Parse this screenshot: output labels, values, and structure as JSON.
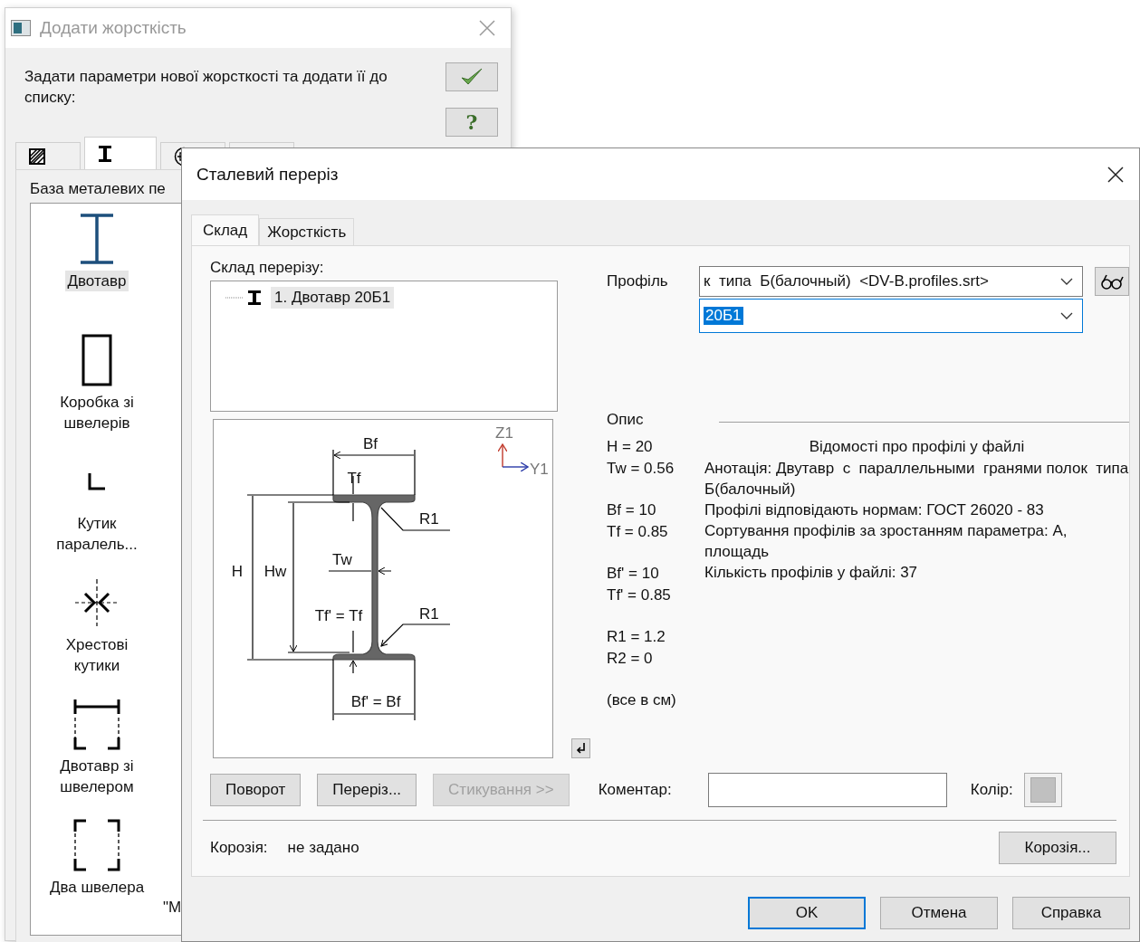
{
  "back_window": {
    "title": "Додати жорсткість",
    "active": false,
    "instruction": "Задати параметри нової жорсткості та додати її до списку:",
    "help_button": "?",
    "tabs": [
      {
        "kind": "hatch",
        "selected": false
      },
      {
        "kind": "ibeam",
        "selected": true
      },
      {
        "kind": "cross",
        "selected": false
      },
      {
        "kind": "blank",
        "selected": false
      }
    ],
    "database_label": "База металевих пе",
    "sections": [
      {
        "label": "Двотавр",
        "kind": "ibeam",
        "selected": true
      },
      {
        "label": "Коробка зі швелерів",
        "kind": "box",
        "selected": false
      },
      {
        "label": "Кутик паралель...",
        "kind": "angle",
        "selected": false
      },
      {
        "label": "Хрестові кутики",
        "kind": "cross",
        "selected": false
      },
      {
        "label": "Двотавр зі швелером",
        "kind": "ibeam_channels",
        "selected": false
      },
      {
        "label": "Два швелера",
        "kind": "channels",
        "selected": false
      }
    ],
    "second_column_labels": [
      "\"М"
    ]
  },
  "dialog": {
    "title": "Сталевий переріз",
    "tabs": [
      {
        "label": "Склад",
        "selected": true
      },
      {
        "label": "Жорсткість",
        "selected": false
      }
    ],
    "composition_label": "Склад перерізу:",
    "composition_tree": [
      {
        "label": "1. Двотавр 20Б1",
        "selected": true
      }
    ],
    "diagram_labels": [
      "Bf",
      "Tf",
      "R1",
      "Tw",
      "H",
      "Hw",
      "Tf' = Tf",
      "R1",
      "Bf' = Bf",
      "Z1",
      "Y1"
    ],
    "profile_label": "Профіль",
    "profile_source": "к  типа  Б(балочный)  <DV-B.profiles.srt>",
    "profile_size": "20Б1",
    "description_label": "Опис",
    "parameters": [
      [
        "H = 20",
        "Tw = 0.56"
      ],
      [
        "Bf = 10",
        "Tf = 0.85"
      ],
      [
        "Bf' = 10",
        "Tf' = 0.85"
      ],
      [
        "R1 = 1.2",
        "R2 = 0"
      ]
    ],
    "units_note": "(все в см)",
    "file_info": {
      "heading": "Відомості про профілі у файлі",
      "lines": [
        "Анотація: Двутавр  с  параллельными  гранями полок  типа  Б(балочный)",
        "Профілі відповідають нормам: ГОСТ 26020 - 83",
        "Сортування профілів за зростанням параметра: А, площадь",
        "Кількість профілів у файлі: 37"
      ]
    },
    "action_buttons": [
      {
        "label": "Поворот",
        "disabled": false
      },
      {
        "label": "Переріз...",
        "disabled": false
      },
      {
        "label": "Стикування >>",
        "disabled": true
      }
    ],
    "comment_label": "Коментар:",
    "color_label": "Колір:",
    "corrosion_label": "Корозія:",
    "corrosion_value": "не задано",
    "corrosion_button": "Корозія...",
    "dialog_buttons": [
      {
        "label": "OK",
        "default": true
      },
      {
        "label": "Отмена",
        "default": false
      },
      {
        "label": "Справка",
        "default": false
      }
    ]
  }
}
